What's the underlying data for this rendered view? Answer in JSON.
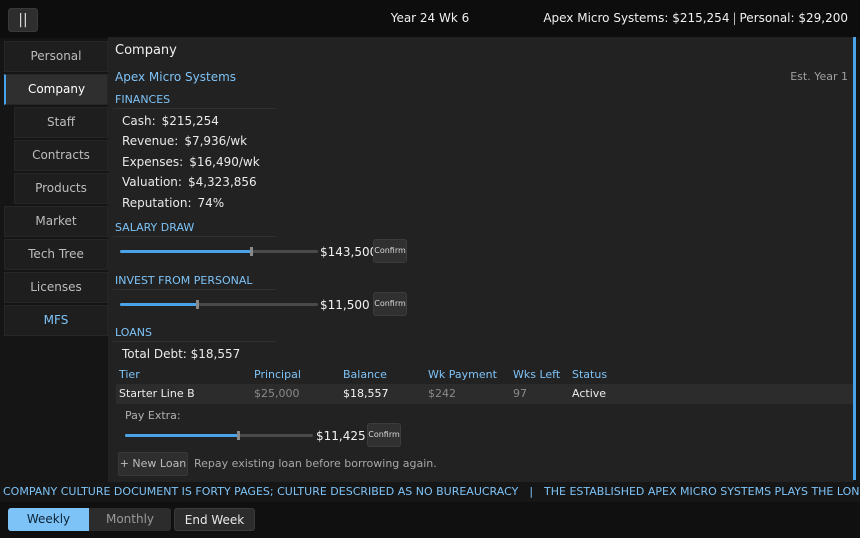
{
  "topbar": {
    "pause_label": "||",
    "year": "Year 24",
    "week": "Wk 6",
    "company_balance": "Apex Micro Systems: $215,254",
    "separator": "|",
    "personal_balance": "Personal: $29,200"
  },
  "sidebar": {
    "items": [
      {
        "label": "Personal"
      },
      {
        "label": "Company"
      },
      {
        "label": "Staff"
      },
      {
        "label": "Contracts"
      },
      {
        "label": "Products"
      },
      {
        "label": "Market"
      },
      {
        "label": "Tech Tree"
      },
      {
        "label": "Licenses"
      },
      {
        "label": "MFS"
      }
    ],
    "active": "Company",
    "accent_color": "#7ec3f7"
  },
  "main": {
    "title": "Company",
    "company_name": "Apex Micro Systems",
    "established": "Est. Year 1",
    "finances": {
      "heading": "FINANCES",
      "stats": [
        {
          "label": "Cash:",
          "value": "$215,254"
        },
        {
          "label": "Revenue:",
          "value": "$7,936/wk"
        },
        {
          "label": "Expenses:",
          "value": "$16,490/wk"
        },
        {
          "label": "Valuation:",
          "value": "$4,323,856"
        },
        {
          "label": "Reputation:",
          "value": "74%"
        }
      ]
    },
    "salary_draw": {
      "heading": "SALARY DRAW",
      "amount": "$143,500",
      "confirm_label": "Confirm",
      "slider_fraction": 0.66
    },
    "invest": {
      "heading": "INVEST FROM PERSONAL",
      "amount": "$11,500",
      "confirm_label": "Confirm",
      "slider_fraction": 0.39
    },
    "loans": {
      "heading": "LOANS",
      "total_debt": "Total Debt: $18,557",
      "columns": [
        "Tier",
        "Principal",
        "Balance",
        "Wk Payment",
        "Wks Left",
        "Status"
      ],
      "rows": [
        {
          "tier": "Starter Line B",
          "principal": "$25,000",
          "balance": "$18,557",
          "wk_payment": "$242",
          "wks_left": "97",
          "status": "Active"
        }
      ],
      "pay_extra_label": "Pay Extra:",
      "pay_extra_amount": "$11,425",
      "pay_extra_confirm": "Confirm",
      "pay_extra_fraction": 0.6,
      "new_loan_label": "+ New Loan",
      "hint": "Repay existing loan before borrowing again."
    }
  },
  "ticker": {
    "items": [
      "COMPANY CULTURE DOCUMENT IS FORTY PAGES; CULTURE DESCRIBED AS NO BUREAUCRACY",
      "THE ESTABLISHED APEX MICRO SYSTEMS PLAYS THE LONG GAME"
    ],
    "separator": "|"
  },
  "bottombar": {
    "weekly_label": "Weekly",
    "monthly_label": "Monthly",
    "selected_period": "Weekly",
    "end_week_label": "End Week"
  }
}
